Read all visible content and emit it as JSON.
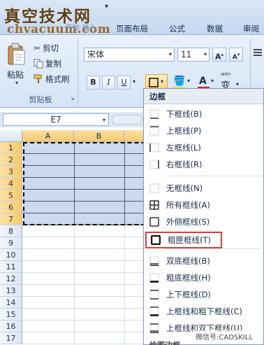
{
  "watermark": {
    "line1": "真空技术网",
    "line2": "chvacuum.com"
  },
  "tabs": [
    {
      "label": "开始",
      "dim": true
    },
    {
      "label": "插入",
      "dim": true
    },
    {
      "label": "页面布局"
    },
    {
      "label": "公式"
    },
    {
      "label": "数据"
    },
    {
      "label": "审阅"
    }
  ],
  "clipboard": {
    "paste": "粘贴",
    "cut": "剪切",
    "copy": "复制",
    "format_painter": "格式刷",
    "group_label": "剪贴板"
  },
  "font": {
    "name": "宋体",
    "size": "11",
    "grow": "A",
    "shrink": "A",
    "bold": "B",
    "italic": "I",
    "underline": "U",
    "font_color_glyph": "A",
    "phonetic": "变"
  },
  "formula_bar": {
    "name_box": "E7"
  },
  "grid": {
    "columns": [
      "A",
      "B"
    ],
    "rows": [
      "1",
      "2",
      "3",
      "4",
      "5",
      "6",
      "7",
      "8",
      "9",
      "10",
      "11",
      "12",
      "13",
      "14",
      "15",
      "16",
      "17"
    ],
    "selected_rows": 7
  },
  "menu": {
    "title": "边框",
    "items": [
      {
        "label": "下框线(B)",
        "icon": "bottom-border",
        "key": "O"
      },
      {
        "label": "上框线(P)",
        "icon": "top-border"
      },
      {
        "label": "左框线(L)",
        "icon": "left-border"
      },
      {
        "label": "右框线(R)",
        "icon": "right-border"
      },
      {
        "label": "无框线(N)",
        "icon": "no-border"
      },
      {
        "label": "所有框线(A)",
        "icon": "all-borders"
      },
      {
        "label": "外侧框线(S)",
        "icon": "outside-borders"
      },
      {
        "label": "粗匣框线(T)",
        "icon": "thick-box-border",
        "highlighted": true
      },
      {
        "label": "双底框线(B)",
        "icon": "double-bottom-border"
      },
      {
        "label": "粗底框线(H)",
        "icon": "thick-bottom-border"
      },
      {
        "label": "上下框线(D)",
        "icon": "top-bottom-border"
      },
      {
        "label": "上框线和粗下框线(C)",
        "icon": "top-thick-bottom-border"
      },
      {
        "label": "上框线和双下框线(U)",
        "icon": "top-double-bottom-border"
      }
    ],
    "footer": "绘图边框"
  },
  "wechat_watermark": "微信号:CADSKILL",
  "colors": {
    "highlight_box": "#d9403a",
    "selection": "#ccd9ee",
    "border_button": "#fcd27c"
  }
}
